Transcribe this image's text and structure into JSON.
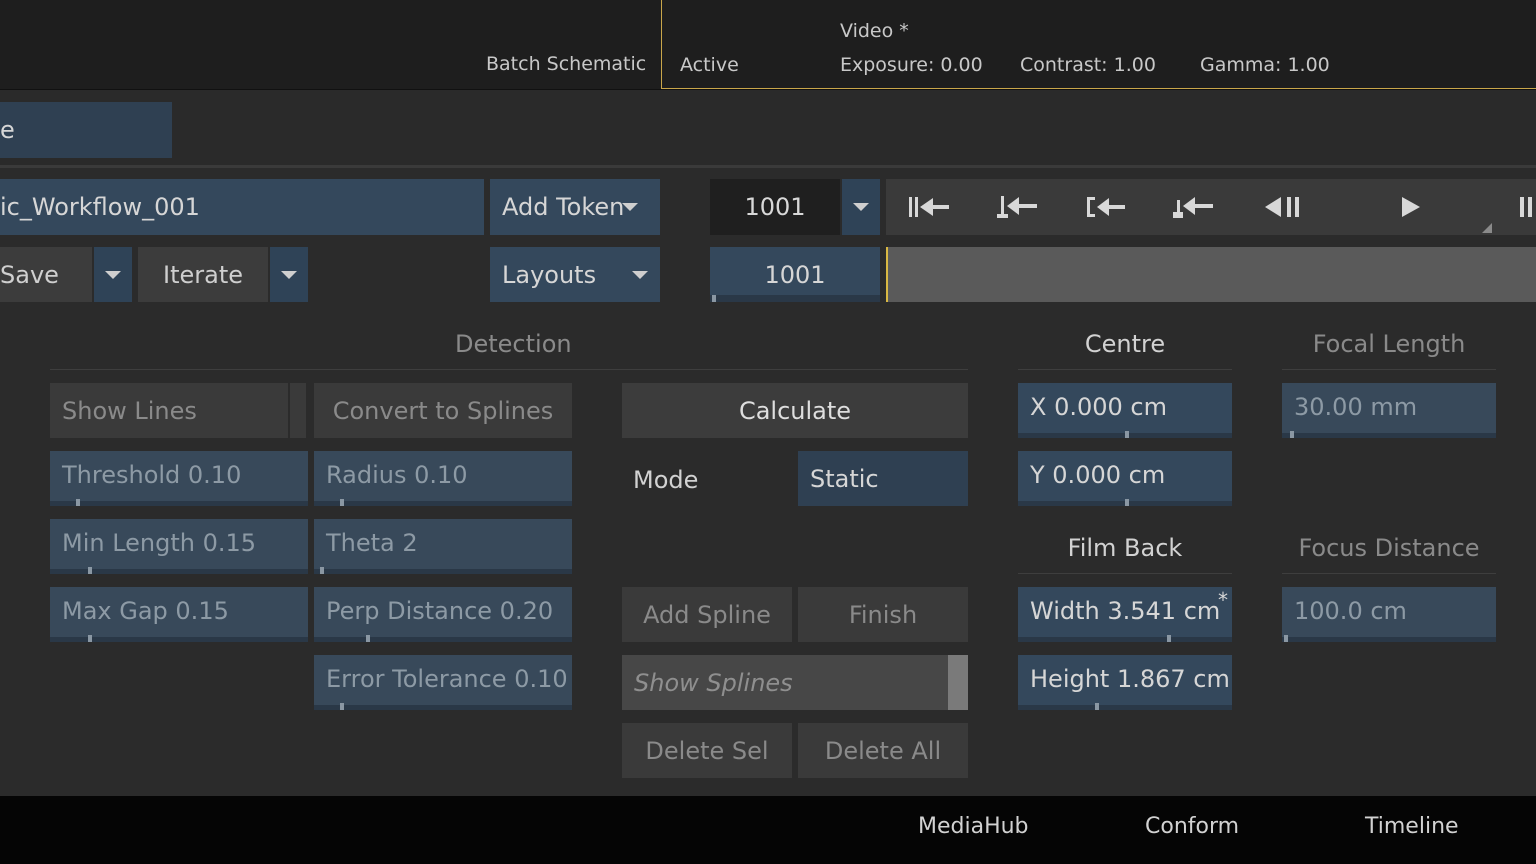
{
  "top": {
    "batch_schematic": "Batch Schematic",
    "active": "Active",
    "video": "Video *",
    "exposure": "Exposure: 0.00",
    "contrast": "Contrast: 1.00",
    "gamma": "Gamma: 1.00"
  },
  "header": {
    "name_field": "e",
    "workflow_name": "ic_Workflow_001",
    "add_token": "Add Token",
    "save": "Save",
    "iterate": "Iterate",
    "layouts": "Layouts"
  },
  "player": {
    "frame_top": "1001",
    "frame_bottom": "1001"
  },
  "detection": {
    "title": "Detection",
    "show_lines": "Show Lines",
    "convert_to_splines": "Convert to Splines",
    "threshold": "Threshold 0.10",
    "radius": "Radius 0.10",
    "min_length": "Min Length 0.15",
    "theta": "Theta 2",
    "max_gap": "Max Gap 0.15",
    "perp_distance": "Perp Distance 0.20",
    "error_tolerance": "Error Tolerance 0.10"
  },
  "calc": {
    "calculate": "Calculate",
    "mode_label": "Mode",
    "mode_value": "Static",
    "add_spline": "Add Spline",
    "finish": "Finish",
    "show_splines": "Show Splines",
    "delete_sel": "Delete Sel",
    "delete_all": "Delete All"
  },
  "centre": {
    "title": "Centre",
    "x": "X 0.000 cm",
    "y": "Y 0.000 cm"
  },
  "film_back": {
    "title": "Film Back",
    "width": "Width 3.541 cm",
    "width_marker": "*",
    "height": "Height 1.867 cm"
  },
  "focal": {
    "title": "Focal Length",
    "value": "30.00 mm"
  },
  "focus": {
    "title": "Focus Distance",
    "value": "100.0 cm"
  },
  "bottom": {
    "mediahub": "MediaHub",
    "conform": "Conform",
    "timeline": "Timeline"
  },
  "icons": [
    "skip-to-start-icon",
    "prev-key-icon",
    "prev-in-icon",
    "prev-mark-icon",
    "step-back-icon",
    "play-icon",
    "resize-corner-icon"
  ],
  "colors": {
    "accent_gold": "#c9a64a",
    "field_blue": "#34485c"
  }
}
